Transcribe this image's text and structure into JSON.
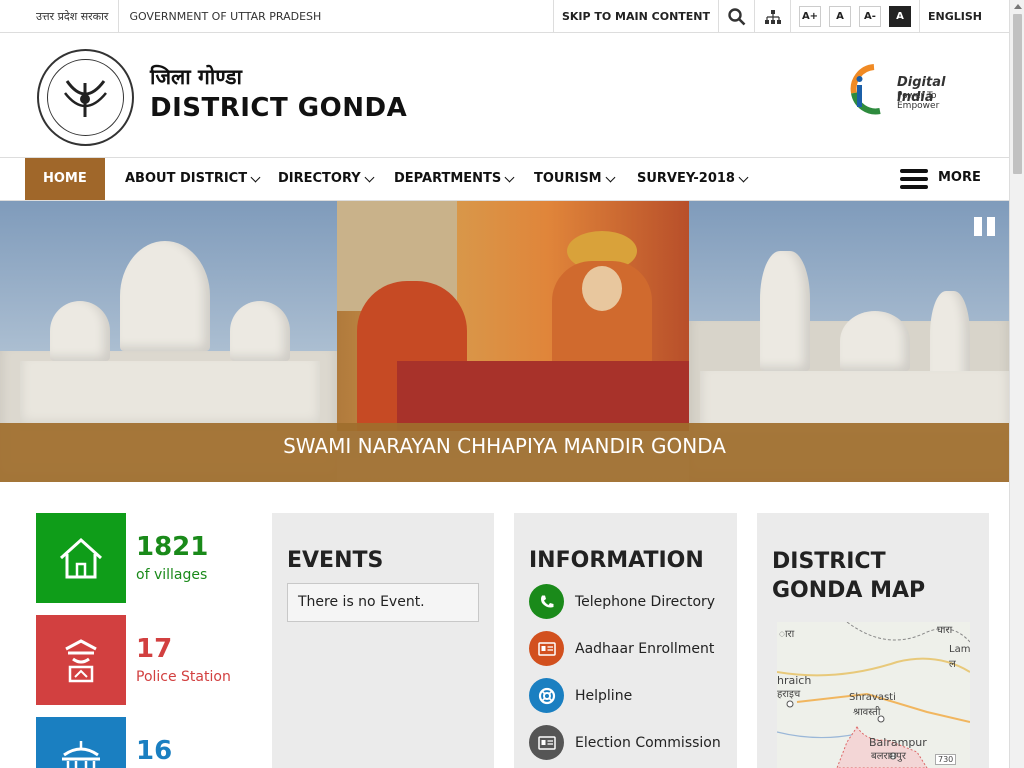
{
  "topbar": {
    "hindi": "उत्तर प्रदेश सरकार",
    "gov": "GOVERNMENT OF UTTAR PRADESH",
    "skip": "SKIP TO MAIN CONTENT",
    "font_plus": "A+",
    "font_normal": "A",
    "font_minus": "A-",
    "contrast": "A",
    "language": "ENGLISH"
  },
  "header": {
    "title_hi": "जिला गोण्डा",
    "title_en": "DISTRICT GONDA",
    "digital_india": "Digital India",
    "digital_india_tagline": "Power To Empower"
  },
  "nav": {
    "home": "HOME",
    "about": "ABOUT DISTRICT",
    "directory": "DIRECTORY",
    "departments": "DEPARTMENTS",
    "tourism": "TOURISM",
    "survey": "SURVEY-2018",
    "more": "MORE"
  },
  "slider": {
    "caption": "SWAMI NARAYAN CHHAPIYA MANDIR GONDA"
  },
  "stats": [
    {
      "value": "1821",
      "label": "of villages",
      "color": "#1a8a1a"
    },
    {
      "value": "17",
      "label": "Police Station",
      "color": "#d24040"
    },
    {
      "value": "16",
      "label": "",
      "color": "#1a7fc1"
    }
  ],
  "events": {
    "title": "EVENTS",
    "empty": "There is no Event."
  },
  "information": {
    "title": "INFORMATION",
    "items": [
      {
        "label": "Telephone Directory",
        "icon": "phone-icon",
        "color": "#1a8a1a"
      },
      {
        "label": "Aadhaar Enrollment",
        "icon": "id-card-icon",
        "color": "#d2501e"
      },
      {
        "label": "Helpline",
        "icon": "lifebuoy-icon",
        "color": "#1a7fc1"
      },
      {
        "label": "Election Commission",
        "icon": "id-card-icon",
        "color": "#555555"
      }
    ]
  },
  "map_panel": {
    "title": "DISTRICT GONDA MAP",
    "labels": [
      "ारा",
      "घारा",
      "Lam",
      "ल",
      "hraich",
      "हराइच",
      "Shravasti",
      "श्रावस्ती",
      "Balrampur",
      "बलरामपुर",
      "730"
    ]
  }
}
